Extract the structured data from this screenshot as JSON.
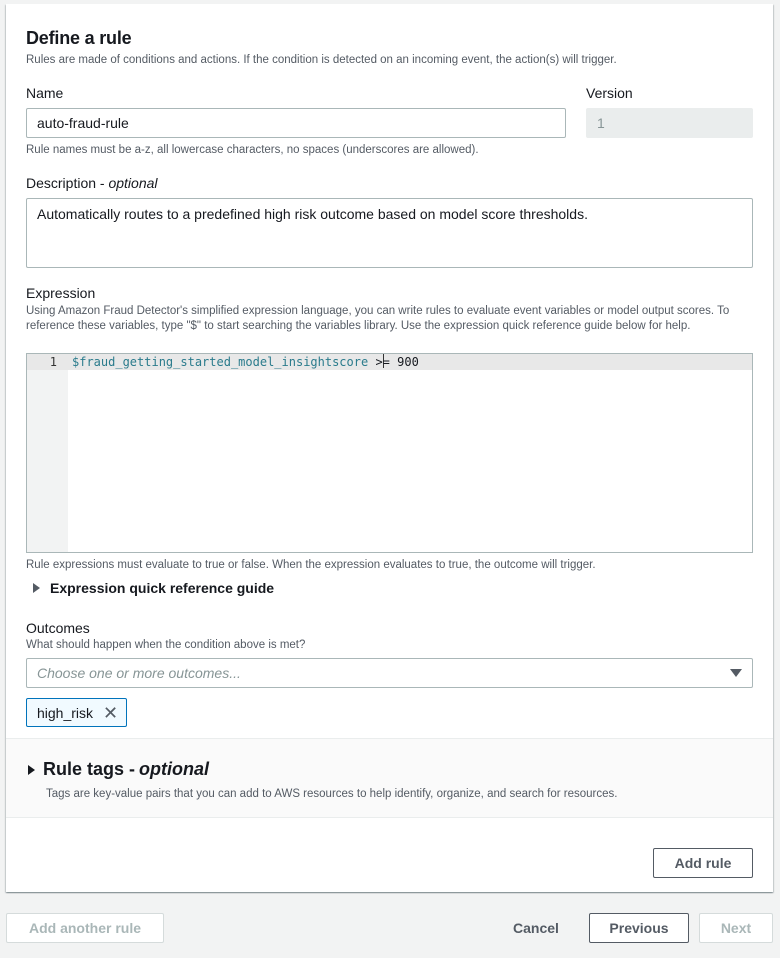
{
  "section": {
    "title": "Define a rule",
    "subtitle": "Rules are made of conditions and actions. If the condition is detected on an incoming event, the action(s) will trigger."
  },
  "name_field": {
    "label": "Name",
    "value": "auto-fraud-rule",
    "hint": "Rule names must be a-z, all lowercase characters, no spaces (underscores are allowed)."
  },
  "version_field": {
    "label": "Version",
    "value": "1"
  },
  "description_field": {
    "label": "Description - ",
    "label_optional": "optional",
    "value": "Automatically routes to a predefined high risk outcome based on model score thresholds."
  },
  "expression_field": {
    "label": "Expression",
    "help": "Using Amazon Fraud Detector's simplified expression language, you can write rules to evaluate event variables or model output scores. To reference these variables, type \"$\" to start searching the variables library. Use the expression quick reference guide below for help.",
    "line_number": "1",
    "code_variable": "$fraud_getting_started_model_insightscore",
    "code_operator_a": " >",
    "code_operator_b": "= 900",
    "hint": "Rule expressions must evaluate to true or false. When the expression evaluates to true, the outcome will trigger.",
    "guide_label": "Expression quick reference guide"
  },
  "outcomes_field": {
    "label": "Outcomes",
    "help": "What should happen when the condition above is met?",
    "placeholder": "Choose one or more outcomes...",
    "selected": [
      {
        "label": "high_risk"
      }
    ]
  },
  "rule_tags": {
    "title": "Rule tags - ",
    "title_optional": "optional",
    "description": "Tags are key-value pairs that you can add to AWS resources to help identify, organize, and search for resources."
  },
  "buttons": {
    "add_rule": "Add rule",
    "add_another_rule": "Add another rule",
    "cancel": "Cancel",
    "previous": "Previous",
    "next": "Next"
  }
}
